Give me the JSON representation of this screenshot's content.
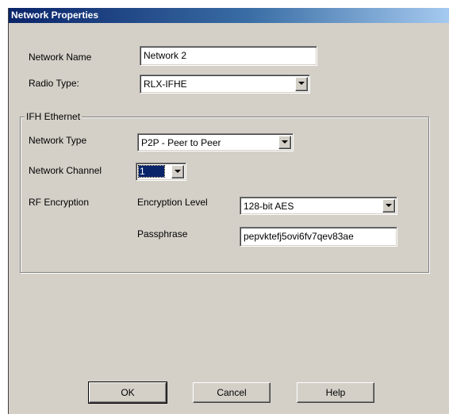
{
  "window": {
    "title": "Network Properties"
  },
  "form": {
    "network_name": {
      "label": "Network Name",
      "value": "Network 2"
    },
    "radio_type": {
      "label": "Radio Type:",
      "value": "RLX-IFHE"
    }
  },
  "ifh_ethernet": {
    "group_label": "IFH Ethernet",
    "network_type": {
      "label": "Network Type",
      "value": "P2P - Peer to Peer"
    },
    "network_channel": {
      "label": "Network Channel",
      "value": "1"
    },
    "rf_encryption": {
      "label": "RF Encryption",
      "encryption_level": {
        "label": "Encryption Level",
        "value": "128-bit AES"
      },
      "passphrase": {
        "label": "Passphrase",
        "value": "pepvktefj5ovi6fv7qev83ae"
      }
    }
  },
  "buttons": {
    "ok": "OK",
    "cancel": "Cancel",
    "help": "Help"
  },
  "icons": {
    "dropdown": "chevron-down-icon"
  },
  "colors": {
    "dialog_face": "#d4d0c8",
    "titlebar_start": "#0a246a",
    "titlebar_end": "#a6caf0",
    "selection": "#0a246a"
  }
}
